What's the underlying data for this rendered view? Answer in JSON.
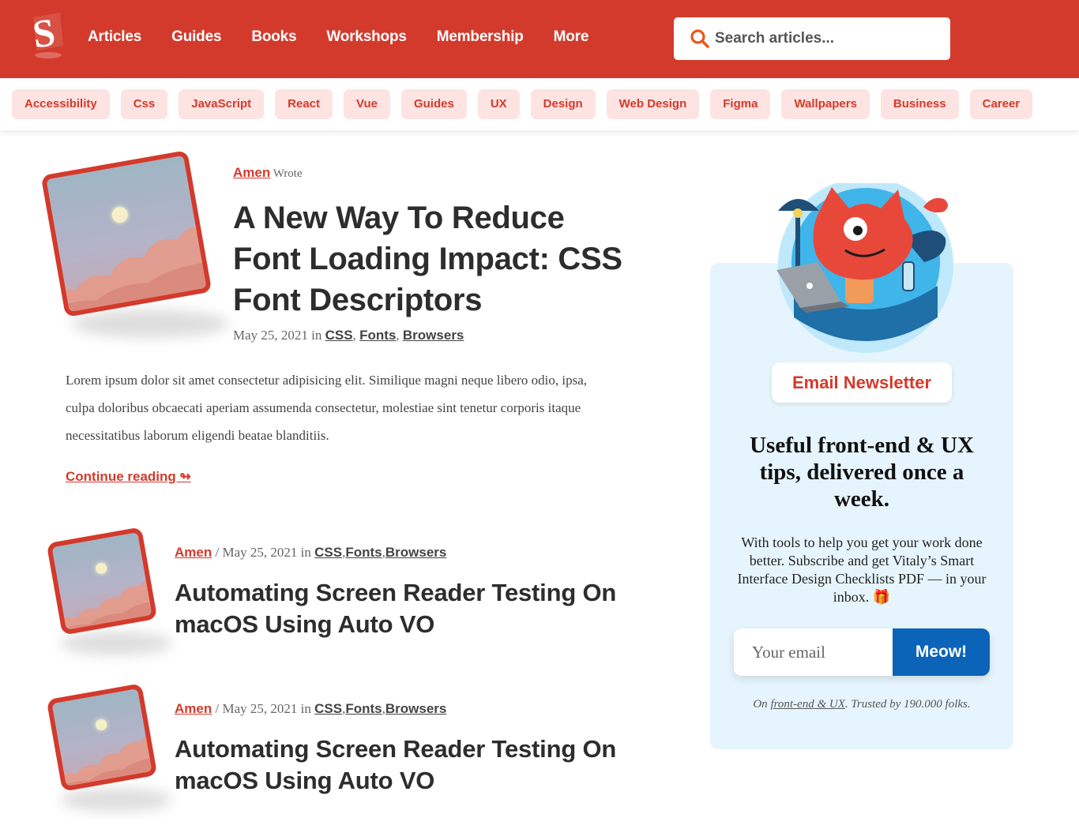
{
  "header": {
    "logo_letter": "S",
    "nav": [
      "Articles",
      "Guides",
      "Books",
      "Workshops",
      "Membership",
      "More"
    ],
    "search_placeholder": "Search articles..."
  },
  "tags": [
    "Accessibility",
    "Css",
    "JavaScript",
    "React",
    "Vue",
    "Guides",
    "UX",
    "Design",
    "Web Design",
    "Figma",
    "Wallpapers",
    "Business",
    "Career"
  ],
  "featured": {
    "author": "Amen",
    "wrote": "Wrote",
    "title": "A New Way To Reduce Font Loading Impact: CSS Font Descriptors",
    "date": "May 25, 2021",
    "in": "in",
    "categories": [
      "CSS",
      "Fonts",
      "Browsers"
    ],
    "excerpt": "Lorem ipsum dolor sit amet consectetur adipisicing elit. Similique magni neque libero odio, ipsa, culpa doloribus obcaecati aperiam assumenda consectetur, molestiae sint tenetur corporis itaque necessitatibus laborum eligendi beatae blanditiis.",
    "continue": "Continue reading ↬"
  },
  "articles": [
    {
      "author": "Amen",
      "sep": "/",
      "date": "May 25, 2021",
      "in": "in",
      "categories": [
        "CSS",
        "Fonts",
        "Browsers"
      ],
      "title": "Automating Screen Reader Testing On macOS Using Auto VO"
    },
    {
      "author": "Amen",
      "sep": "/",
      "date": "May 25, 2021",
      "in": "in",
      "categories": [
        "CSS",
        "Fonts",
        "Browsers"
      ],
      "title": "Automating Screen Reader Testing On macOS Using Auto VO"
    }
  ],
  "newsletter": {
    "badge": "Email Newsletter",
    "heading": "Useful front-end & UX tips, delivered once a week.",
    "body": "With tools to help you get your work done better. Subscribe and get Vitaly’s Smart Interface Design Checklists PDF — in your inbox. 🎁",
    "email_placeholder": "Your email",
    "button": "Meow!",
    "foot_prefix": "On ",
    "foot_link": "front-end & UX",
    "foot_suffix": ". Trusted by 190.000 folks."
  },
  "colors": {
    "brand_red": "#d33a2c",
    "tag_bg": "#fde3e1",
    "sidebar_bg": "#e6f5fd",
    "button_blue": "#0b64b8"
  }
}
